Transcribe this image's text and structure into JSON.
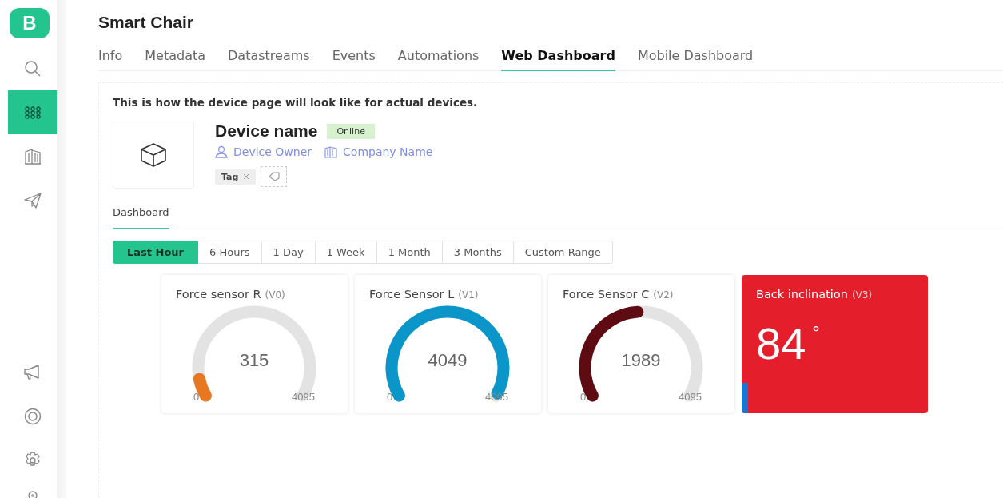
{
  "logo": {
    "letter": "B"
  },
  "sidebar": {
    "items": [
      {
        "selected": false
      },
      {
        "selected": true
      },
      {
        "selected": false
      },
      {
        "selected": false
      }
    ]
  },
  "page": {
    "title": "Smart Chair"
  },
  "tabs": [
    {
      "label": "Info",
      "selected": false
    },
    {
      "label": "Metadata",
      "selected": false
    },
    {
      "label": "Datastreams",
      "selected": false
    },
    {
      "label": "Events",
      "selected": false
    },
    {
      "label": "Automations",
      "selected": false
    },
    {
      "label": "Web Dashboard",
      "selected": true
    },
    {
      "label": "Mobile Dashboard",
      "selected": false
    }
  ],
  "preview": {
    "note": "This is how the device page will look like for actual devices.",
    "device": {
      "name": "Device name",
      "status": "Online",
      "owner": "Device Owner",
      "company": "Company Name",
      "tags": [
        "Tag"
      ]
    },
    "subtabs": [
      {
        "label": "Dashboard",
        "selected": true
      }
    ],
    "time_ranges": [
      {
        "label": "Last Hour",
        "selected": true
      },
      {
        "label": "6 Hours",
        "selected": false
      },
      {
        "label": "1 Day",
        "selected": false
      },
      {
        "label": "1 Week",
        "selected": false
      },
      {
        "label": "1 Month",
        "selected": false
      },
      {
        "label": "3 Months",
        "selected": false
      },
      {
        "label": "Custom Range",
        "selected": false
      }
    ],
    "widgets": [
      {
        "kind": "gauge",
        "title": "Force sensor R",
        "pin": "(V0)",
        "value": "315",
        "min": "0",
        "max": "4095",
        "color": "#e87722"
      },
      {
        "kind": "gauge",
        "title": "Force Sensor L",
        "pin": "(V1)",
        "value": "4049",
        "min": "0",
        "max": "4095",
        "color": "#0a96c8"
      },
      {
        "kind": "gauge",
        "title": "Force Sensor C",
        "pin": "(V2)",
        "value": "1989",
        "min": "0",
        "max": "4095",
        "color": "#5e0c12"
      },
      {
        "kind": "value",
        "title": "Back inclination",
        "pin": "(V3)",
        "value": "84",
        "unit": "°",
        "color": "#e41f2b"
      }
    ]
  }
}
